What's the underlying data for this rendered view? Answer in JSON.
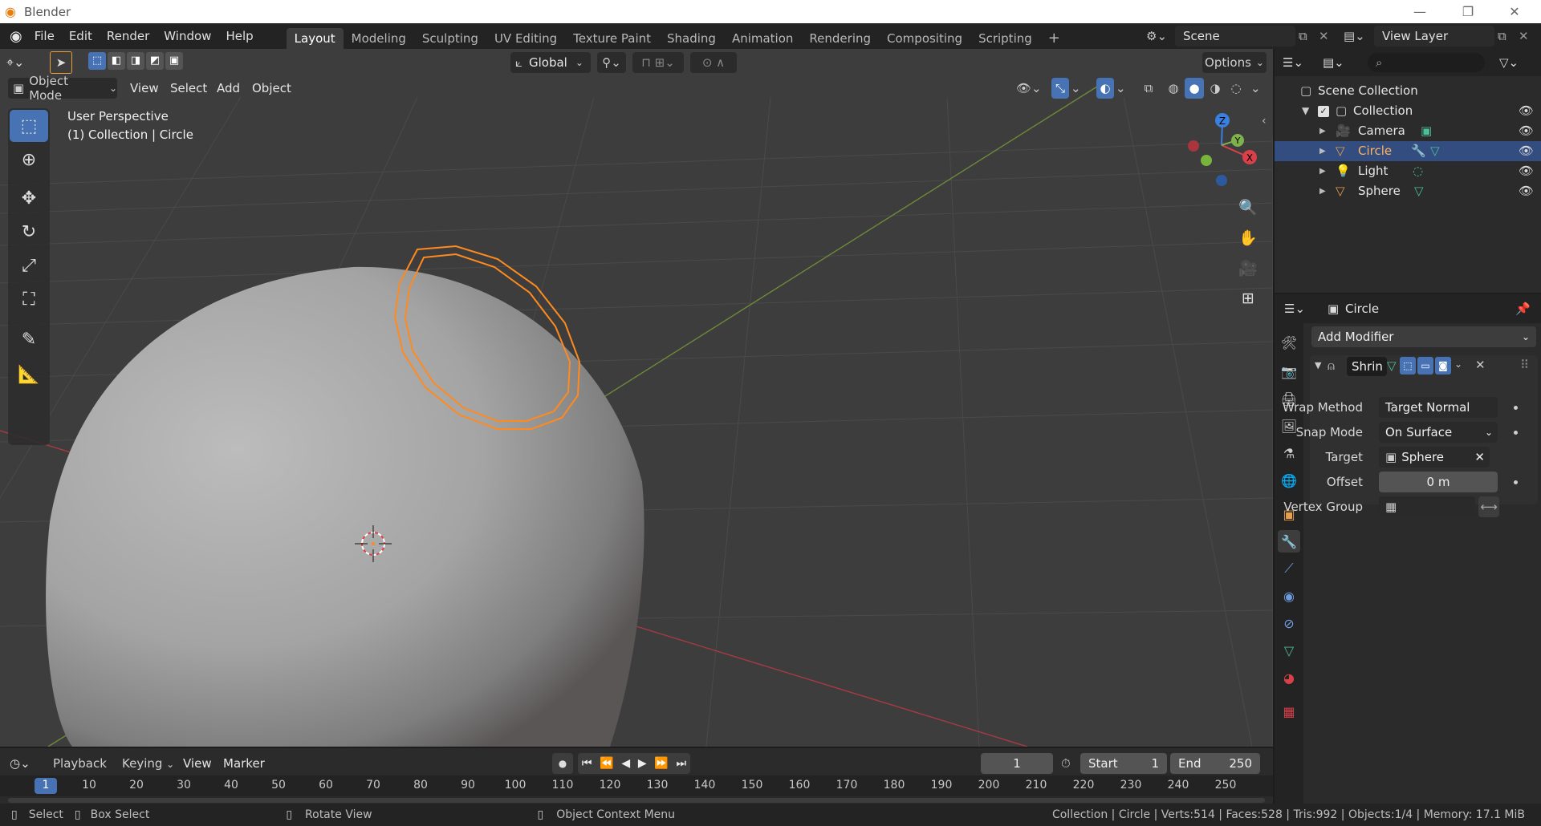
{
  "window": {
    "title": "Blender",
    "minimize": "—",
    "restore": "❐",
    "close": "✕"
  },
  "menu": {
    "items": [
      "File",
      "Edit",
      "Render",
      "Window",
      "Help"
    ]
  },
  "workspaces": [
    "Layout",
    "Modeling",
    "Sculpting",
    "UV Editing",
    "Texture Paint",
    "Shading",
    "Animation",
    "Rendering",
    "Compositing",
    "Scripting"
  ],
  "active_workspace": "Layout",
  "scene": {
    "label": "Scene",
    "view_layer": "View Layer"
  },
  "viewport": {
    "mode": "Object Mode",
    "menus": [
      "View",
      "Select",
      "Add",
      "Object"
    ],
    "transform_orientation": "Global",
    "options": "Options",
    "overlay_title": "User Perspective",
    "overlay_subtitle": "(1) Collection | Circle",
    "gizmo": {
      "x": "X",
      "y": "Y",
      "z": "Z"
    }
  },
  "outliner": {
    "root": "Scene Collection",
    "collection": "Collection",
    "items": [
      {
        "name": "Camera",
        "selected": false,
        "color": "#e6a04c"
      },
      {
        "name": "Circle",
        "selected": true,
        "color": "#e6a04c"
      },
      {
        "name": "Light",
        "selected": false,
        "color": "#e6a04c"
      },
      {
        "name": "Sphere",
        "selected": false,
        "color": "#e6a04c"
      }
    ]
  },
  "properties": {
    "object_name": "Circle",
    "add_modifier": "Add Modifier",
    "modifier_name": "Shrin",
    "rows": [
      {
        "label": "Wrap Method",
        "value": "Target Normal Pr..."
      },
      {
        "label": "Snap Mode",
        "value": "On Surface"
      },
      {
        "label": "Target",
        "value": "Sphere"
      },
      {
        "label": "Offset",
        "value": "0 m"
      },
      {
        "label": "Vertex Group",
        "value": ""
      }
    ]
  },
  "timeline": {
    "menus": [
      "Playback",
      "Keying",
      "View",
      "Marker"
    ],
    "current_frame": "1",
    "start_label": "Start",
    "start": "1",
    "end_label": "End",
    "end": "250",
    "ruler": [
      "1",
      "10",
      "20",
      "30",
      "40",
      "50",
      "60",
      "70",
      "80",
      "90",
      "100",
      "110",
      "120",
      "130",
      "140",
      "150",
      "160",
      "170",
      "180",
      "190",
      "200",
      "210",
      "220",
      "230",
      "240",
      "250"
    ]
  },
  "statusbar": {
    "select": "Select",
    "box_select": "Box Select",
    "rotate_view": "Rotate View",
    "context_menu": "Object Context Menu",
    "stats": "Collection | Circle | Verts:514 | Faces:528 | Tris:992 | Objects:1/4 | Memory: 17.1 MiB"
  },
  "colors": {
    "accent": "#4772b3",
    "selection": "#334d80",
    "orange": "#ff8a1e",
    "x_axis": "#d9404a",
    "y_axis": "#7fb24a",
    "z_axis": "#3a80e0"
  }
}
